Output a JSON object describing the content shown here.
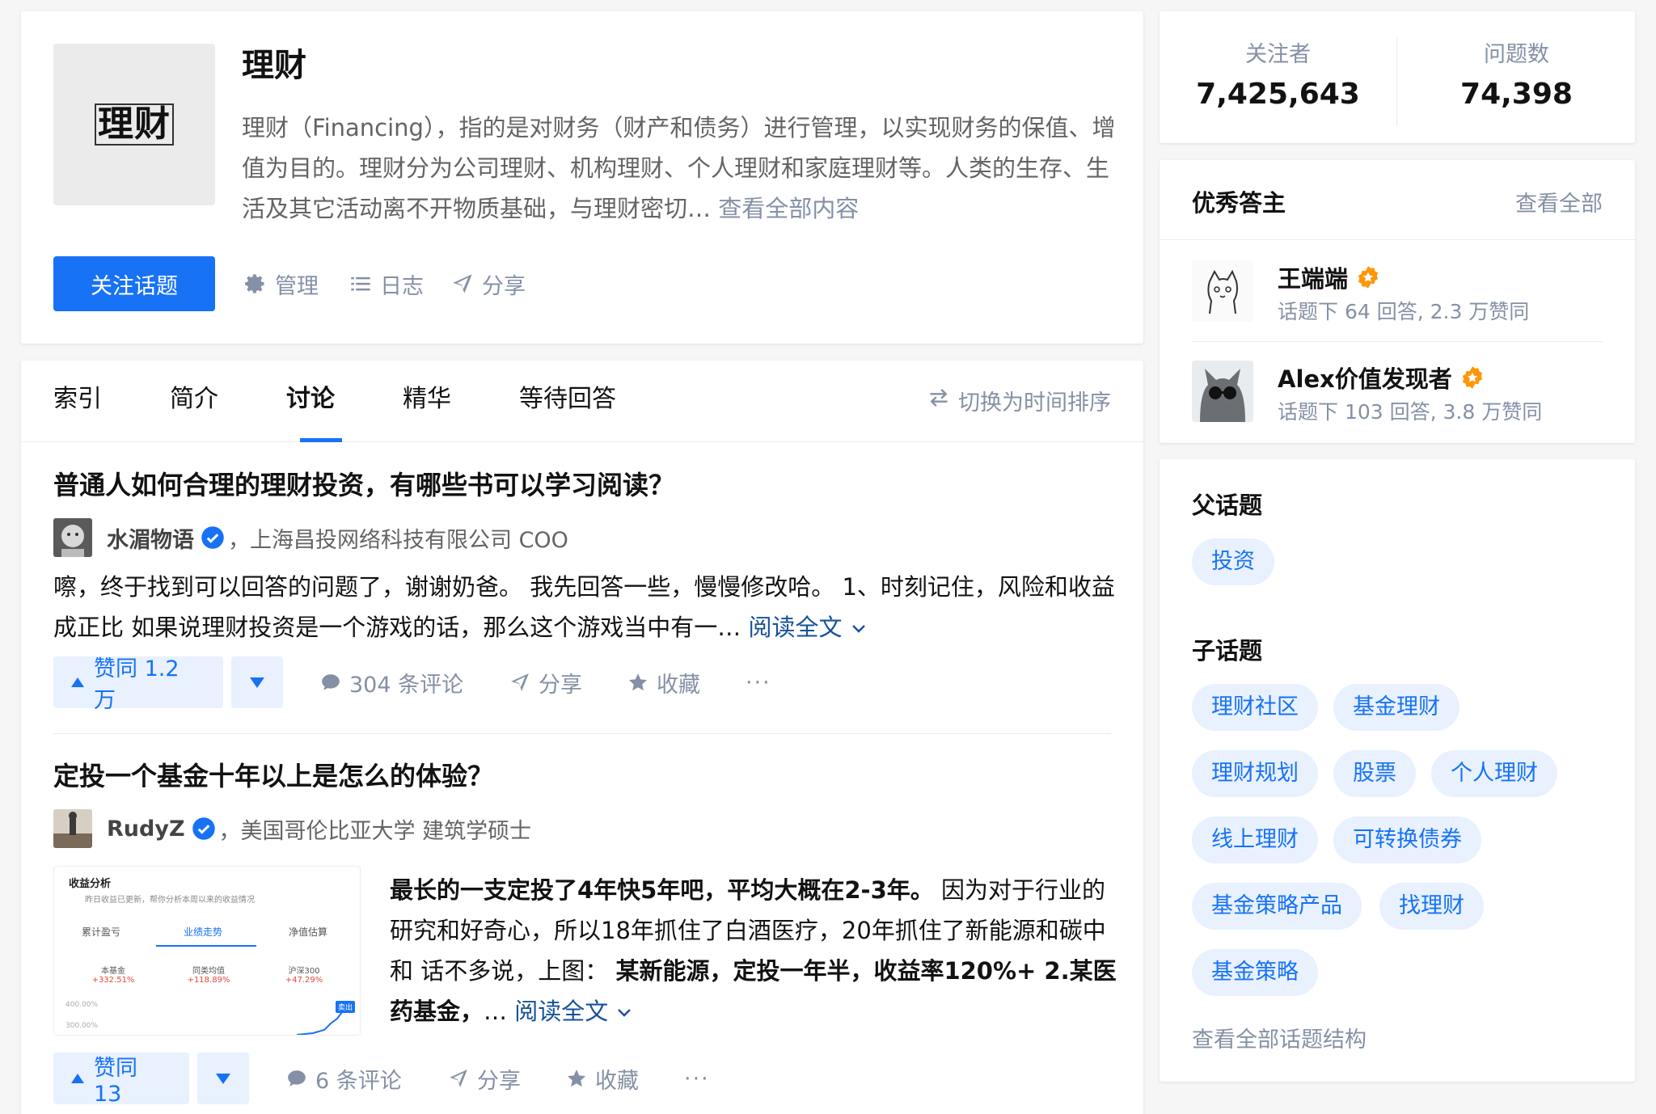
{
  "topic": {
    "logo_text": "理财",
    "title": "理财",
    "description": "理财（Financing），指的是对财务（财产和债务）进行管理，以实现财务的保值、增值为目的。理财分为公司理财、机构理财、个人理财和家庭理财等。人类的生存、生活及其它活动离不开物质基础，与理财密切… ",
    "view_all": "查看全部内容",
    "follow_button": "关注话题",
    "actions": {
      "manage": "管理",
      "log": "日志",
      "share": "分享"
    }
  },
  "tabs": {
    "items": [
      "索引",
      "简介",
      "讨论",
      "精华",
      "等待回答"
    ],
    "active": "讨论",
    "sort_toggle": "切换为时间排序"
  },
  "feed": [
    {
      "question": "普通人如何合理的理财投资，有哪些书可以学习阅读？",
      "author": "水湄物语",
      "author_desc": "，上海昌投网络科技有限公司 COO",
      "excerpt": "嚓，终于找到可以回答的问题了，谢谢奶爸。 我先回答一些，慢慢修改哈。 1、时刻记住，风险和收益成正比 如果说理财投资是一个游戏的话，那么这个游戏当中有一…",
      "read_more": "阅读全文",
      "vote": "赞同 1.2 万",
      "comments": "304 条评论",
      "share": "分享",
      "collect": "收藏",
      "more": "···"
    },
    {
      "question": "定投一个基金十年以上是怎么的体验？",
      "author": "RudyZ",
      "author_desc": "，美国哥伦比亚大学 建筑学硕士",
      "excerpt_bold_1": "最长的一支定投了4年快5年吧，平均大概在2-3年。",
      "excerpt_mid": " 因为对于行业的研究和好奇心，所以18年抓住了白酒医疗，20年抓住了新能源和碳中和 话不多说，上图： ",
      "excerpt_bold_2": "某新能源，定投一年半，收益率120%+ 2.某医药基金，",
      "excerpt_tail": "… ",
      "read_more": "阅读全文",
      "vote": "赞同 13",
      "comments": "6 条评论",
      "share": "分享",
      "collect": "收藏",
      "more": "···",
      "thumbnail": {
        "title": "收益分析",
        "subtitle": "昨日收益已更新，帮你分析本周以来的收益情况",
        "tabs": [
          "累计盈亏",
          "业绩走势",
          "净值估算"
        ],
        "legend": [
          {
            "name": "本基金",
            "value": "+332.51%"
          },
          {
            "name": "同类均值",
            "value": "+118.89%"
          },
          {
            "name": "沪深300",
            "value": "+47.29%"
          }
        ],
        "axis": [
          "400.00%",
          "300.00%"
        ],
        "sell_tag": "卖出"
      }
    }
  ],
  "stats": {
    "followers_label": "关注者",
    "followers_value": "7,425,643",
    "questions_label": "问题数",
    "questions_value": "74,398"
  },
  "answerers": {
    "title": "优秀答主",
    "view_all": "查看全部",
    "items": [
      {
        "name": "王端端",
        "meta": "话题下 64 回答, 2.3 万赞同"
      },
      {
        "name": "Alex价值发现者",
        "meta": "话题下 103 回答, 3.8 万赞同"
      }
    ]
  },
  "topics": {
    "parent_title": "父话题",
    "parents": [
      "投资"
    ],
    "child_title": "子话题",
    "children": [
      "理财社区",
      "基金理财",
      "理财规划",
      "股票",
      "个人理财",
      "线上理财",
      "可转换债券",
      "基金策略产品",
      "找理财",
      "基金策略"
    ],
    "view_structure": "查看全部话题结构"
  },
  "colors": {
    "brand": "#1772f6",
    "link": "#175199",
    "muted": "#8590a6",
    "badge": "#ff9607"
  }
}
